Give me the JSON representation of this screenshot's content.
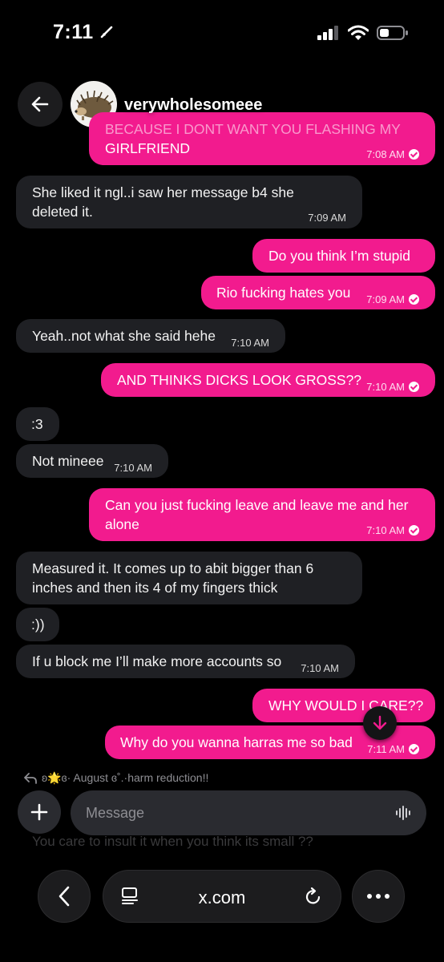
{
  "status_bar": {
    "time": "7:11"
  },
  "header": {
    "username": "verywholesomeee"
  },
  "messages": [
    {
      "text": "BECAUSE I DONT WANT YOU FLASHING MY",
      "text2": "GIRLFRIEND",
      "time": "7:08 AM"
    },
    {
      "text": "She liked it ngl..i saw her message b4 she deleted it.",
      "time": "7:09 AM"
    },
    {
      "text": "Do you think I’m stupid"
    },
    {
      "text": "Rio fucking hates you",
      "time": "7:09 AM"
    },
    {
      "text": "Yeah..not what she said hehe",
      "time": "7:10 AM"
    },
    {
      "text": "AND THINKS DICKS LOOK GROSS??",
      "time": "7:10 AM"
    },
    {
      "text": ":3"
    },
    {
      "text": "Not mineee",
      "time": "7:10 AM"
    },
    {
      "text": "Can you just fucking leave and leave me and her alone",
      "time": "7:10 AM"
    },
    {
      "text": "Measured it. It comes up to abit bigger than 6 inches and then its 4 of my fingers thick"
    },
    {
      "text": ":))"
    },
    {
      "text": "If u block me I’ll make more accounts so",
      "time": "7:10 AM"
    },
    {
      "text": "WHY WOULD I CARE??"
    },
    {
      "text": "Why do you wanna harras me so bad",
      "time": "7:11 AM"
    }
  ],
  "reply_preview": {
    "text": "ʚ🌟ɞ· August ɞ˚.·harm reduction!!"
  },
  "composer": {
    "placeholder": "Message",
    "ghost_text": "You care to insult it when you think its small ??"
  },
  "browser": {
    "url": "x.com"
  }
}
